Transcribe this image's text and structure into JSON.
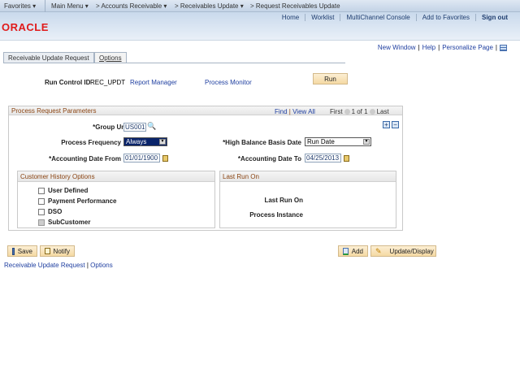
{
  "nav": {
    "favorites": "Favorites",
    "main_menu": "Main Menu",
    "crumbs": [
      "Accounts Receivable",
      "Receivables Update",
      "Request Receivables Update"
    ]
  },
  "header": {
    "links": [
      "Home",
      "Worklist",
      "MultiChannel Console",
      "Add to Favorites",
      "Sign out"
    ],
    "logo": "ORACLE"
  },
  "page_links": {
    "new_window": "New Window",
    "help": "Help",
    "personalize": "Personalize Page"
  },
  "tabs": [
    "Receivable Update Request",
    "Options"
  ],
  "run_control": {
    "label": "Run Control ID",
    "value": "REC_UPDT",
    "report_manager": "Report Manager",
    "process_monitor": "Process Monitor",
    "run": "Run"
  },
  "params": {
    "title": "Process Request Parameters",
    "find": "Find",
    "view_all": "View All",
    "first": "First",
    "count": "1 of 1",
    "last": "Last",
    "group_unit_label": "*Group Unit",
    "group_unit": "US001",
    "freq_label": "Process Frequency",
    "freq": "Always",
    "hb_label": "*High Balance Basis Date",
    "hb": "Run Date",
    "from_label": "*Accounting Date From",
    "from": "01/01/1900",
    "to_label": "*Accounting Date To",
    "to": "04/25/2013"
  },
  "history": {
    "title": "Customer History Options",
    "options": [
      "User Defined",
      "Payment Performance",
      "DSO",
      "SubCustomer"
    ]
  },
  "last_run": {
    "title": "Last Run On",
    "last_run_on": "Last Run On",
    "process_instance": "Process Instance"
  },
  "buttons": {
    "save": "Save",
    "notify": "Notify",
    "add": "Add",
    "update": "Update/Display"
  },
  "footer_links": [
    "Receivable Update Request",
    "Options"
  ],
  "colors": {
    "accent_link": "#1f3fa0",
    "oracle_red": "#e01b1b",
    "button": "#f5d9a3"
  }
}
